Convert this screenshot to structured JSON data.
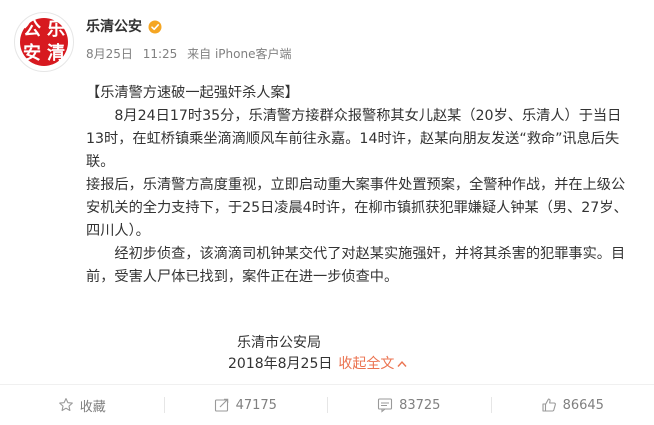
{
  "account": {
    "name": "乐清公安",
    "avatar_chars": [
      "公",
      "乐",
      "安",
      "清"
    ],
    "verified_color": "#f5a623"
  },
  "post": {
    "date": "8月25日",
    "time": "11:25",
    "source": "来自 iPhone客户端",
    "title": "【乐清警方速破一起强奸杀人案】",
    "paragraphs": [
      "8月24日17时35分，乐清警方接群众报警称其女儿赵某（20岁、乐清人）于当日13时，在虹桥镇乘坐滴滴顺风车前往永嘉。14时许，赵某向朋友发送“救命”讯息后失联。",
      "接报后，乐清警方高度重视，立即启动重大案事件处置预案，全警种作战，并在上级公安机关的全力支持下，于25日凌晨4时许，在柳市镇抓获犯罪嫌疑人钟某（男、27岁、四川人）。",
      "经初步侦查，该滴滴司机钟某交代了对赵某实施强奸，并将其杀害的犯罪事实。目前，受害人尸体已找到，案件正在进一步侦查中。"
    ],
    "signature": "乐清市公安局",
    "signed_date": "2018年8月25日",
    "expand_label": "收起全文",
    "link_color": "#eb7350"
  },
  "actions": {
    "favorite": "收藏",
    "repost": "47175",
    "comment": "83725",
    "like": "86645"
  }
}
